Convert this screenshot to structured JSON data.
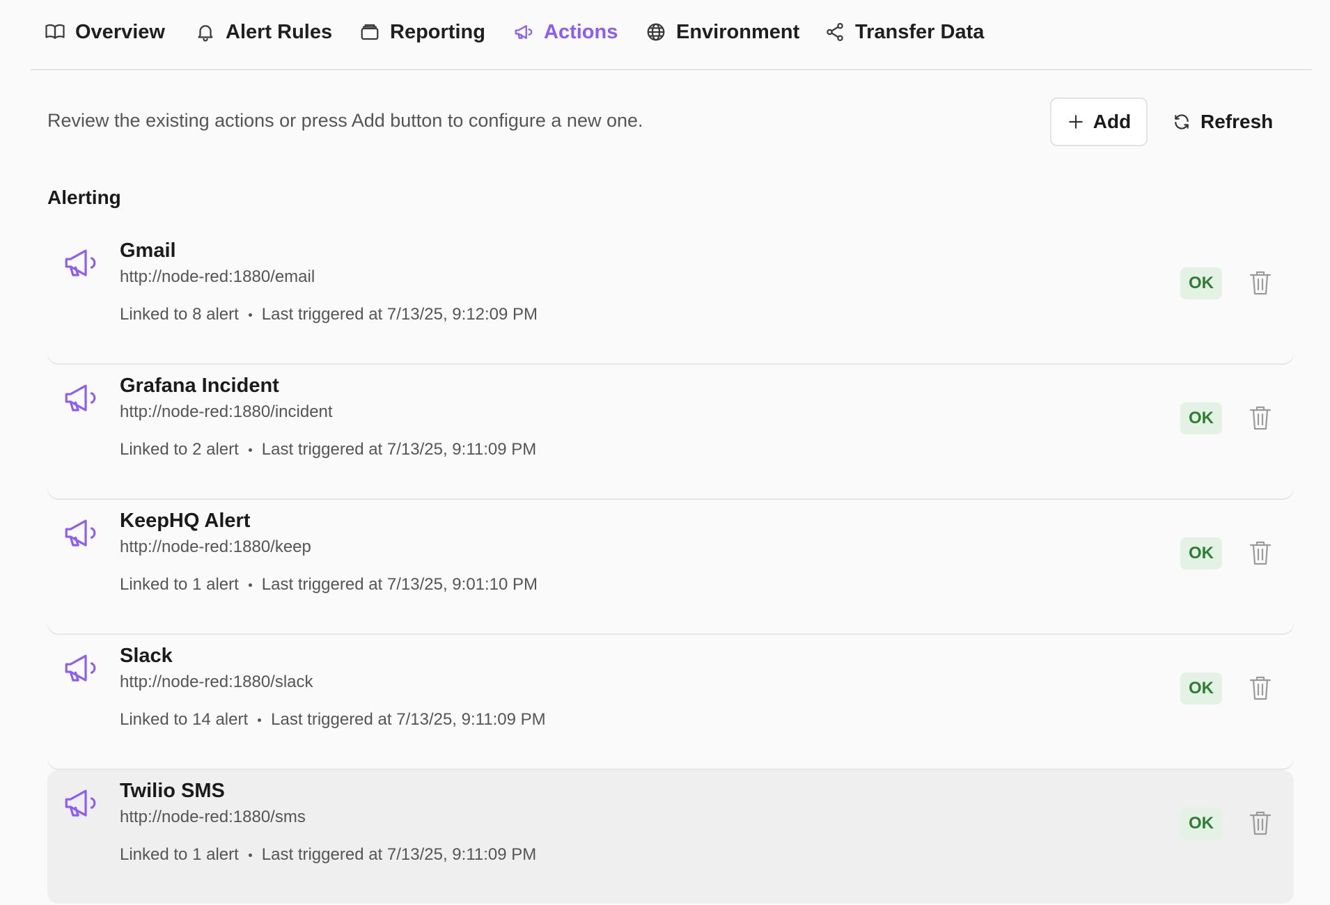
{
  "tabs": [
    {
      "label": "Overview",
      "icon": "book-icon"
    },
    {
      "label": "Alert Rules",
      "icon": "bell-icon"
    },
    {
      "label": "Reporting",
      "icon": "archive-icon"
    },
    {
      "label": "Actions",
      "icon": "megaphone-icon",
      "active": true
    },
    {
      "label": "Environment",
      "icon": "globe-icon"
    },
    {
      "label": "Transfer Data",
      "icon": "share-icon"
    }
  ],
  "toolbar": {
    "intro": "Review the existing actions or press Add button to configure a new one.",
    "add_label": "Add",
    "refresh_label": "Refresh"
  },
  "section": {
    "title": "Alerting"
  },
  "actions": [
    {
      "name": "Gmail",
      "url": "http://node-red:1880/email",
      "linked": "Linked to 8 alert",
      "last": "Last triggered at 7/13/25, 9:12:09 PM",
      "status": "OK"
    },
    {
      "name": "Grafana Incident",
      "url": "http://node-red:1880/incident",
      "linked": "Linked to 2 alert",
      "last": "Last triggered at 7/13/25, 9:11:09 PM",
      "status": "OK"
    },
    {
      "name": "KeepHQ Alert",
      "url": "http://node-red:1880/keep",
      "linked": "Linked to 1 alert",
      "last": "Last triggered at 7/13/25, 9:01:10 PM",
      "status": "OK"
    },
    {
      "name": "Slack",
      "url": "http://node-red:1880/slack",
      "linked": "Linked to 14 alert",
      "last": "Last triggered at 7/13/25, 9:11:09 PM",
      "status": "OK"
    },
    {
      "name": "Twilio SMS",
      "url": "http://node-red:1880/sms",
      "linked": "Linked to 1 alert",
      "last": "Last triggered at 7/13/25, 9:11:09 PM",
      "status": "OK"
    }
  ],
  "colors": {
    "accent": "#8b5cf6",
    "ok_bg": "#e3f2e4",
    "ok_text": "#2e7d32"
  }
}
